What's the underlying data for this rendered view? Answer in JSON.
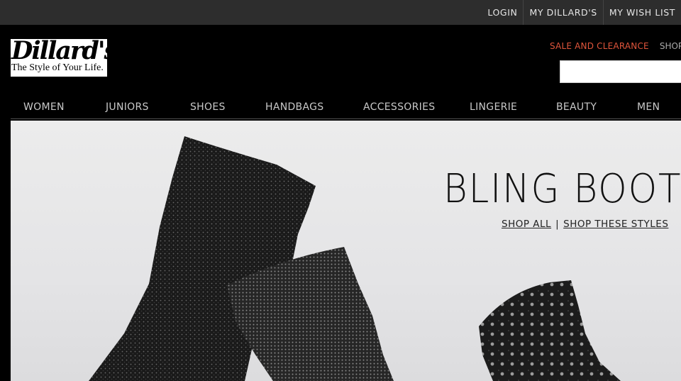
{
  "utility_nav": {
    "login": "LOGIN",
    "my_dillards": "MY DILLARD'S",
    "wish_list": "MY WISH LIST"
  },
  "logo": {
    "name": "Dillard's",
    "tagline": "The Style of Your Life."
  },
  "header": {
    "sale_link": "SALE AND CLEARANCE",
    "shop_link": "SHOP B",
    "search_placeholder": ""
  },
  "main_nav": {
    "items": [
      {
        "label": "WOMEN"
      },
      {
        "label": "JUNIORS"
      },
      {
        "label": "SHOES"
      },
      {
        "label": "HANDBAGS"
      },
      {
        "label": "ACCESSORIES"
      },
      {
        "label": "LINGERIE"
      },
      {
        "label": "BEAUTY"
      },
      {
        "label": "MEN"
      }
    ]
  },
  "hero": {
    "title": "BLING BOOT",
    "shop_all": "SHOP ALL",
    "separator": "|",
    "shop_styles": "SHOP THESE STYLES"
  },
  "colors": {
    "utility_bar": "#2d2d2d",
    "header_bg": "#000000",
    "sale_accent": "#e0553b",
    "hero_bg": "#ececec"
  }
}
